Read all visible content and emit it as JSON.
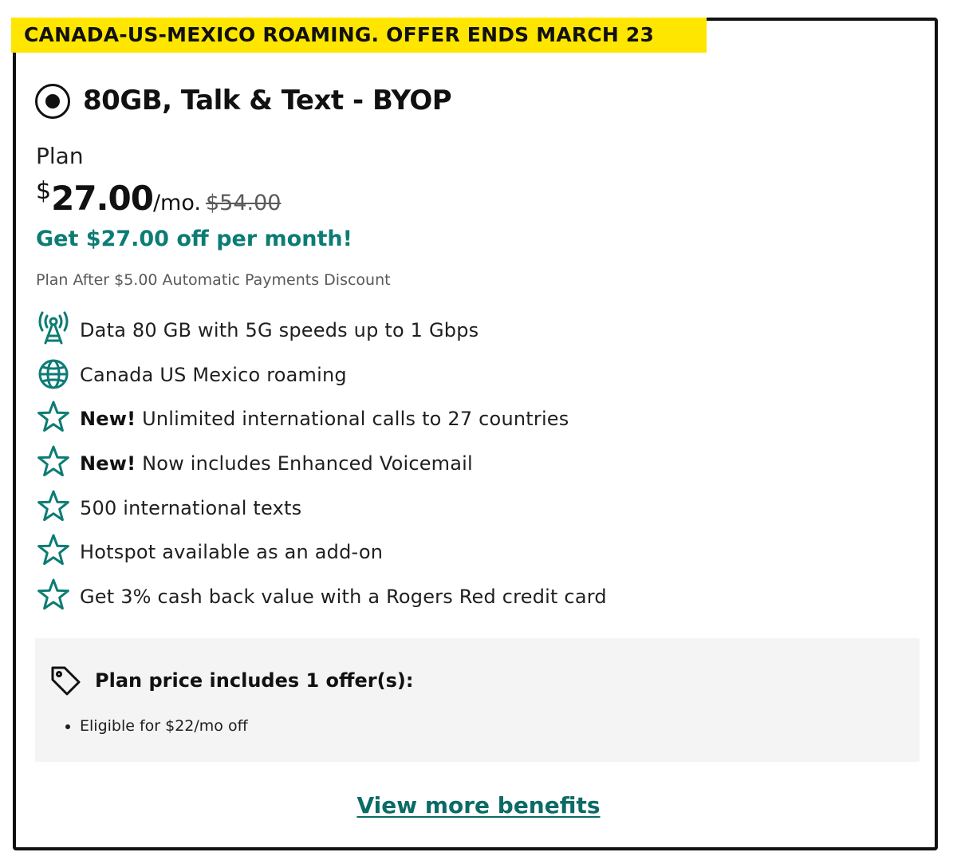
{
  "banner": {
    "text": "CANADA-US-MEXICO ROAMING. OFFER ENDS MARCH 23",
    "background_color": "#ffe600"
  },
  "plan": {
    "title": "80GB, Talk & Text - BYOP",
    "selected": true,
    "label": "Plan",
    "currency": "$",
    "price": "27.00",
    "per": "/mo.",
    "original_price": "$54.00",
    "savings": "Get $27.00 off per month!",
    "discount_note": "Plan After $5.00 Automatic Payments Discount"
  },
  "features": [
    {
      "icon": "cell-tower-icon",
      "prefix": "",
      "text": "Data 80 GB with 5G speeds up to 1 Gbps"
    },
    {
      "icon": "globe-icon",
      "prefix": "",
      "text": "Canada US Mexico roaming"
    },
    {
      "icon": "star-icon",
      "prefix": "New!",
      "text": " Unlimited international calls to 27 countries"
    },
    {
      "icon": "star-icon",
      "prefix": "New!",
      "text": " Now includes Enhanced Voicemail"
    },
    {
      "icon": "star-icon",
      "prefix": "",
      "text": "500 international texts"
    },
    {
      "icon": "star-icon",
      "prefix": "",
      "text": "Hotspot available as an add-on"
    },
    {
      "icon": "star-icon",
      "prefix": "",
      "text": "Get 3% cash back value with a Rogers Red credit card"
    }
  ],
  "offers": {
    "icon": "price-tag-icon",
    "title": "Plan price includes 1 offer(s):",
    "items": [
      "Eligible for $22/mo off"
    ]
  },
  "links": {
    "view_more": "View more benefits"
  },
  "colors": {
    "accent_teal": "#0c7c74",
    "text_dark": "#111111",
    "muted": "#595959",
    "offer_bg": "#f4f4f4"
  }
}
